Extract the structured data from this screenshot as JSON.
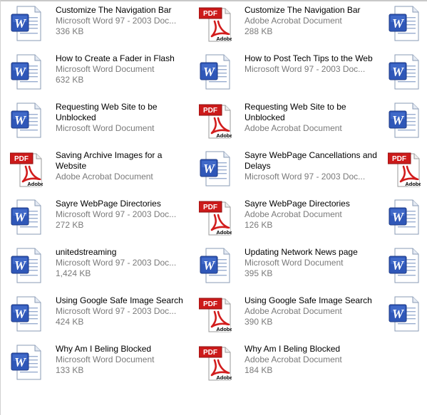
{
  "files": [
    {
      "name": "Customize The Navigation Bar",
      "type": "Microsoft Word 97 - 2003 Doc...",
      "size": "336 KB",
      "icon": "word-document-icon"
    },
    {
      "name": "Customize The Navigation Bar",
      "type": "Adobe Acrobat Document",
      "size": "288 KB",
      "icon": "pdf-document-icon"
    },
    {
      "name": "",
      "type": "",
      "size": "",
      "icon": "word-document-icon"
    },
    {
      "name": "How to Create a Fader in Flash",
      "type": "Microsoft Word Document",
      "size": "632 KB",
      "icon": "word-document-icon"
    },
    {
      "name": "How to Post Tech Tips to the Web",
      "type": "Microsoft Word 97 - 2003 Doc...",
      "size": "",
      "icon": "word-document-icon"
    },
    {
      "name": "",
      "type": "",
      "size": "",
      "icon": "word-document-icon"
    },
    {
      "name": "Requesting Web Site to be Unblocked",
      "type": "Microsoft Word Document",
      "size": "",
      "icon": "word-document-icon"
    },
    {
      "name": "Requesting Web Site to be Unblocked",
      "type": "Adobe Acrobat Document",
      "size": "",
      "icon": "pdf-document-icon"
    },
    {
      "name": "",
      "type": "",
      "size": "",
      "icon": "word-document-icon"
    },
    {
      "name": "Saving Archive Images for a Website",
      "type": "Adobe Acrobat Document",
      "size": "",
      "icon": "pdf-document-icon"
    },
    {
      "name": "Sayre WebPage Cancellations and Delays",
      "type": "Microsoft Word 97 - 2003 Doc...",
      "size": "",
      "icon": "word-document-icon"
    },
    {
      "name": "",
      "type": "",
      "size": "",
      "icon": "pdf-document-icon"
    },
    {
      "name": "Sayre WebPage Directories",
      "type": "Microsoft Word 97 - 2003 Doc...",
      "size": "272 KB",
      "icon": "word-document-icon"
    },
    {
      "name": "Sayre WebPage Directories",
      "type": "Adobe Acrobat Document",
      "size": "126 KB",
      "icon": "pdf-document-icon"
    },
    {
      "name": "",
      "type": "",
      "size": "",
      "icon": "word-document-icon"
    },
    {
      "name": "unitedstreaming",
      "type": "Microsoft Word 97 - 2003 Doc...",
      "size": "1,424 KB",
      "icon": "word-document-icon"
    },
    {
      "name": "Updating Network News page",
      "type": "Microsoft Word Document",
      "size": "395 KB",
      "icon": "word-document-icon"
    },
    {
      "name": "",
      "type": "",
      "size": "",
      "icon": "word-document-icon"
    },
    {
      "name": "Using Google Safe Image Search",
      "type": "Microsoft Word 97 - 2003 Doc...",
      "size": "424 KB",
      "icon": "word-document-icon"
    },
    {
      "name": "Using Google Safe Image Search",
      "type": "Adobe Acrobat Document",
      "size": "390 KB",
      "icon": "pdf-document-icon"
    },
    {
      "name": "",
      "type": "",
      "size": "",
      "icon": "word-document-icon"
    },
    {
      "name": "Why Am I Beling Blocked",
      "type": "Microsoft Word Document",
      "size": "133 KB",
      "icon": "word-document-icon"
    },
    {
      "name": "Why Am I Beling Blocked",
      "type": "Adobe Acrobat Document",
      "size": "184 KB",
      "icon": "pdf-document-icon"
    }
  ],
  "colors": {
    "word_blue": "#2f57b8",
    "pdf_red": "#cc1a1a",
    "subtext": "#7a7a7a"
  }
}
